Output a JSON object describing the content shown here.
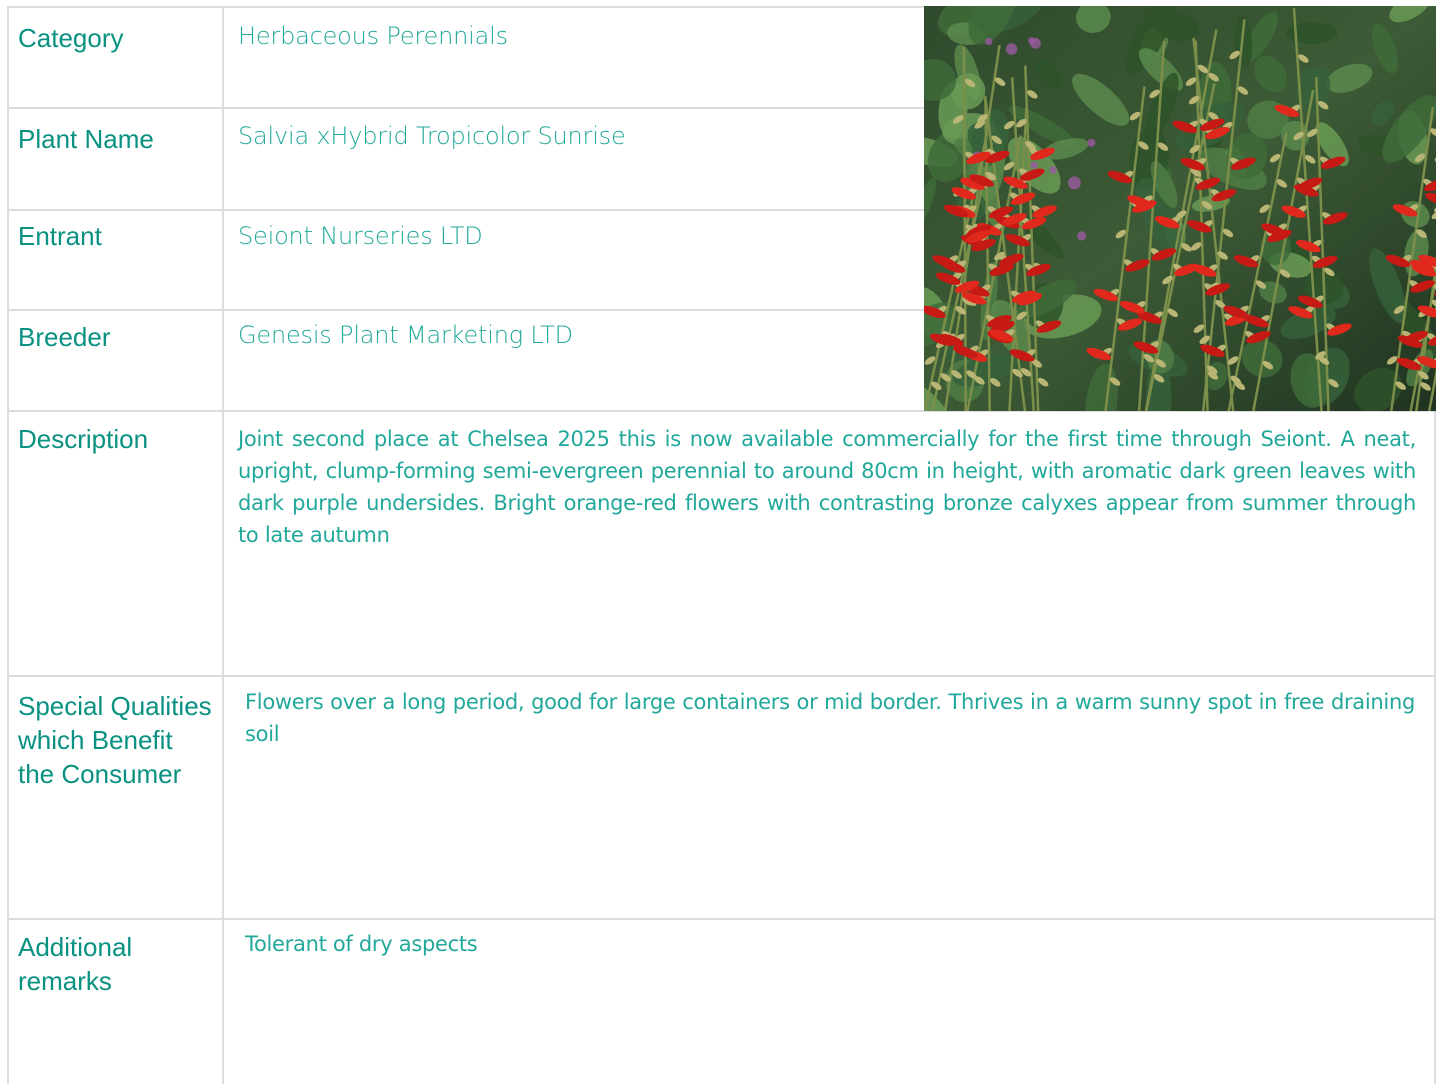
{
  "rows": {
    "category": {
      "label": "Category",
      "value": "Herbaceous Perennials"
    },
    "plant_name": {
      "label": "Plant Name",
      "value": "Salvia xHybrid Tropicolor Sunrise"
    },
    "entrant": {
      "label": "Entrant",
      "value": "Seiont Nurseries LTD"
    },
    "breeder": {
      "label": "Breeder",
      "value": "Genesis Plant Marketing LTD"
    },
    "description": {
      "label": "Description",
      "value": "Joint second place at Chelsea 2025 this is now available commercially for the first time through Seiont. A neat, upright, clump-forming semi-evergreen perennial to around 80cm in height, with aromatic dark green leaves with dark purple undersides. Bright orange-red flowers with contrasting bronze calyxes appear from summer through to late autumn"
    },
    "special_qualities": {
      "label": "Special Qualities which Benefit the Consumer",
      "value": "Flowers over a long period, good for large containers or mid border. Thrives in a warm sunny spot in free draining soil"
    },
    "additional_remarks": {
      "label": "Additional remarks",
      "value": "Tolerant of dry aspects"
    }
  },
  "colors": {
    "accent": "#099181",
    "value_text": "#21a89a",
    "border": "#dcdcdc"
  }
}
